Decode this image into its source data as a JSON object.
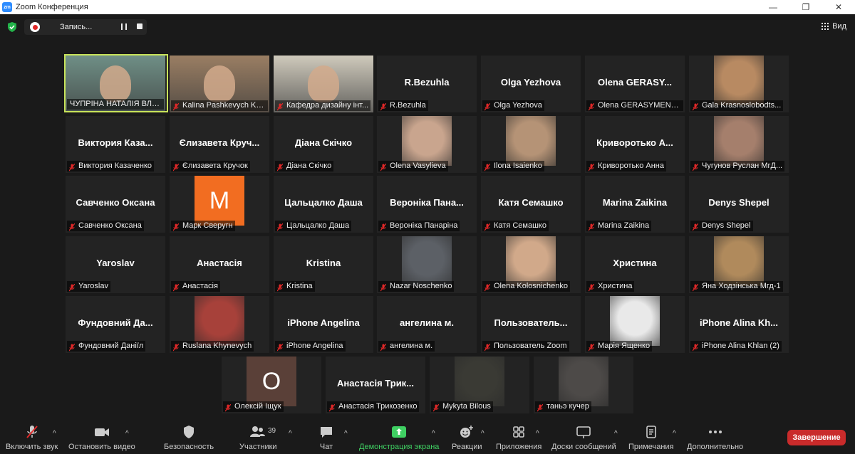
{
  "window": {
    "app_icon_text": "zm",
    "title": "Zoom Конференция",
    "minimize": "—",
    "restore": "❐",
    "close": "✕"
  },
  "status": {
    "recording_label": "Запись...",
    "view_label": "Вид"
  },
  "participants": [
    {
      "name": "ЧУПРІНА НАТАЛІЯ ВЛА...",
      "video": true,
      "active": true,
      "muted": false,
      "bg": "#6f8f86"
    },
    {
      "name": "Kalina Pashkevych KN...",
      "video": true,
      "muted": true,
      "bg": "#9a7e63"
    },
    {
      "name": "Кафедра дизайну інт...",
      "video": true,
      "muted": true,
      "bg": "#cfcabc"
    },
    {
      "name": "R.Bezuhla",
      "display": "R.Bezuhla",
      "muted": true
    },
    {
      "name": "Olga Yezhova",
      "display": "Olga Yezhova",
      "muted": true
    },
    {
      "name": "Olena GERASYMENKO",
      "display": "Olena  GERASY...",
      "muted": true
    },
    {
      "name": "Gala Krasnoslobodts...",
      "photo": true,
      "muted": true,
      "bg": "#b88a62"
    },
    {
      "name": "Виктория Казаченко",
      "display": "Виктория  Каза...",
      "muted": true
    },
    {
      "name": "Єлизавета Кручок",
      "display": "Єлизавета  Круч...",
      "muted": true
    },
    {
      "name": "Діана Скічко",
      "display": "Діана Скічко",
      "muted": true
    },
    {
      "name": "Olena Vasylieva",
      "photo": true,
      "muted": true,
      "bg": "#c9a58e"
    },
    {
      "name": "Ilona Isaienko",
      "photo": true,
      "muted": true,
      "bg": "#b59376"
    },
    {
      "name": "Криворотько Анна",
      "display": "Криворотько  А...",
      "muted": true
    },
    {
      "name": "Чугунов Руслан МгД...",
      "photo": true,
      "muted": true,
      "bg": "#a57f6c"
    },
    {
      "name": "Савченко Оксана",
      "display": "Савченко Оксана",
      "muted": true
    },
    {
      "name": "Марк Сверугн",
      "letter": "M",
      "muted": true,
      "bg": "#f26d21"
    },
    {
      "name": "Цальцалко Даша",
      "display": "Цальцалко Даша",
      "muted": true
    },
    {
      "name": "Вероніка Панаріна",
      "display": "Вероніка  Пана...",
      "muted": true
    },
    {
      "name": "Катя Семашко",
      "display": "Катя Семашко",
      "muted": true
    },
    {
      "name": "Marina Zaikina",
      "display": "Marina Zaikina",
      "muted": true
    },
    {
      "name": "Denys Shepel",
      "display": "Denys Shepel",
      "muted": true
    },
    {
      "name": "Yaroslav",
      "display": "Yaroslav",
      "muted": true
    },
    {
      "name": "Анастасія",
      "display": "Анастасія",
      "muted": true
    },
    {
      "name": "Kristina",
      "display": "Kristina",
      "muted": true
    },
    {
      "name": "Nazar Noschenko",
      "photo": true,
      "muted": true,
      "bg": "#5c6066"
    },
    {
      "name": "Olena Kolosnichenko",
      "photo": true,
      "muted": true,
      "bg": "#d1a98a"
    },
    {
      "name": "Христина",
      "display": "Христина",
      "muted": true
    },
    {
      "name": "Яна Ходзінська Мгд-1",
      "photo": true,
      "muted": true,
      "bg": "#b08a5c"
    },
    {
      "name": "Фундовний Даніїл",
      "display": "Фундовний  Да...",
      "muted": true
    },
    {
      "name": "Ruslana Khynevych",
      "photo": true,
      "muted": true,
      "bg": "#a7413a"
    },
    {
      "name": "iPhone Angelina",
      "display": "iPhone Angelina",
      "muted": true
    },
    {
      "name": "ангелина м.",
      "display": "ангелина м.",
      "muted": true
    },
    {
      "name": "Пользователь Zoom",
      "display": "Пользователь...",
      "muted": true
    },
    {
      "name": "Марія Ященко",
      "photo": true,
      "muted": true,
      "bg": "#e9e9e9"
    },
    {
      "name": "iPhone Alina Khlan (2)",
      "display": "iPhone  Alina  Kh...",
      "muted": true
    },
    {
      "name": "Олексій Іщук",
      "letter": "O",
      "muted": true,
      "bg": "#5a4038"
    },
    {
      "name": "Анастасія Трикозенко",
      "display": "Анастасія  Трик...",
      "muted": true
    },
    {
      "name": "Mykyta Bilous",
      "photo": true,
      "muted": true,
      "bg": "#3a3a34"
    },
    {
      "name": "таньэ кучер",
      "photo": true,
      "muted": true,
      "bg": "#4d4a48"
    }
  ],
  "toolbar": {
    "unmute": "Включить звук",
    "start_video": "Остановить видео",
    "security": "Безопасность",
    "participants": "Участники",
    "participants_count": "39",
    "chat": "Чат",
    "share_screen": "Демонстрация экрана",
    "reactions": "Реакции",
    "apps": "Приложения",
    "whiteboards": "Доски сообщений",
    "notes": "Примечания",
    "more": "Дополнительно",
    "end": "Завершение"
  },
  "colors": {
    "accent_green": "#3fcf62",
    "end_red": "#c92b2b",
    "active_speaker": "#c8e35a",
    "zoom_blue": "#2d8cff"
  }
}
